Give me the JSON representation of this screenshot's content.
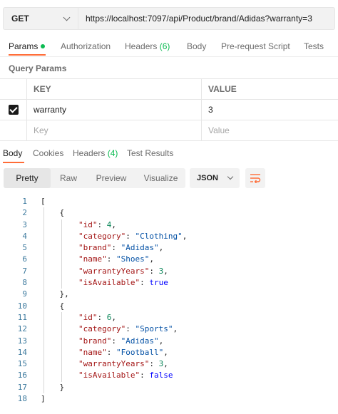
{
  "request": {
    "method": "GET",
    "url": "https://localhost:7097/api/Product/brand/Adidas?warranty=3"
  },
  "request_tabs": [
    {
      "label": "Params",
      "count": "",
      "active": true
    },
    {
      "label": "Authorization",
      "count": "",
      "active": false
    },
    {
      "label": "Headers",
      "count": "(6)",
      "active": false
    },
    {
      "label": "Body",
      "count": "",
      "active": false
    },
    {
      "label": "Pre-request Script",
      "count": "",
      "active": false
    },
    {
      "label": "Tests",
      "count": "",
      "active": false
    }
  ],
  "query_params": {
    "title": "Query Params",
    "headers": {
      "key": "KEY",
      "value": "VALUE"
    },
    "rows": [
      {
        "checked": true,
        "key": "warranty",
        "value": "3"
      }
    ],
    "placeholders": {
      "key": "Key",
      "value": "Value"
    }
  },
  "response_tabs": [
    {
      "label": "Body",
      "count": "",
      "active": true
    },
    {
      "label": "Cookies",
      "count": "",
      "active": false
    },
    {
      "label": "Headers",
      "count": "(4)",
      "active": false
    },
    {
      "label": "Test Results",
      "count": "",
      "active": false
    }
  ],
  "view_modes": [
    "Pretty",
    "Raw",
    "Preview",
    "Visualize"
  ],
  "active_view": "Pretty",
  "format": "JSON",
  "icons": {
    "method_dropdown": "chevron-down-icon",
    "format_dropdown": "chevron-down-icon",
    "wrap": "wrap-lines-icon",
    "checkbox": "checkmark-icon"
  },
  "colors": {
    "accent": "#ff6c37",
    "count": "#0cbb52",
    "line_numbers": "#3d7a9e"
  },
  "code_lines": [
    {
      "n": "1",
      "text": "["
    },
    {
      "n": "2",
      "text": "    {"
    },
    {
      "n": "3",
      "text": "        \"id\": 4,"
    },
    {
      "n": "4",
      "text": "        \"category\": \"Clothing\","
    },
    {
      "n": "5",
      "text": "        \"brand\": \"Adidas\","
    },
    {
      "n": "6",
      "text": "        \"name\": \"Shoes\","
    },
    {
      "n": "7",
      "text": "        \"warrantyYears\": 3,"
    },
    {
      "n": "8",
      "text": "        \"isAvailable\": true"
    },
    {
      "n": "9",
      "text": "    },"
    },
    {
      "n": "10",
      "text": "    {"
    },
    {
      "n": "11",
      "text": "        \"id\": 6,"
    },
    {
      "n": "12",
      "text": "        \"category\": \"Sports\","
    },
    {
      "n": "13",
      "text": "        \"brand\": \"Adidas\","
    },
    {
      "n": "14",
      "text": "        \"name\": \"Football\","
    },
    {
      "n": "15",
      "text": "        \"warrantyYears\": 3,"
    },
    {
      "n": "16",
      "text": "        \"isAvailable\": false"
    },
    {
      "n": "17",
      "text": "    }"
    },
    {
      "n": "18",
      "text": "]"
    }
  ]
}
